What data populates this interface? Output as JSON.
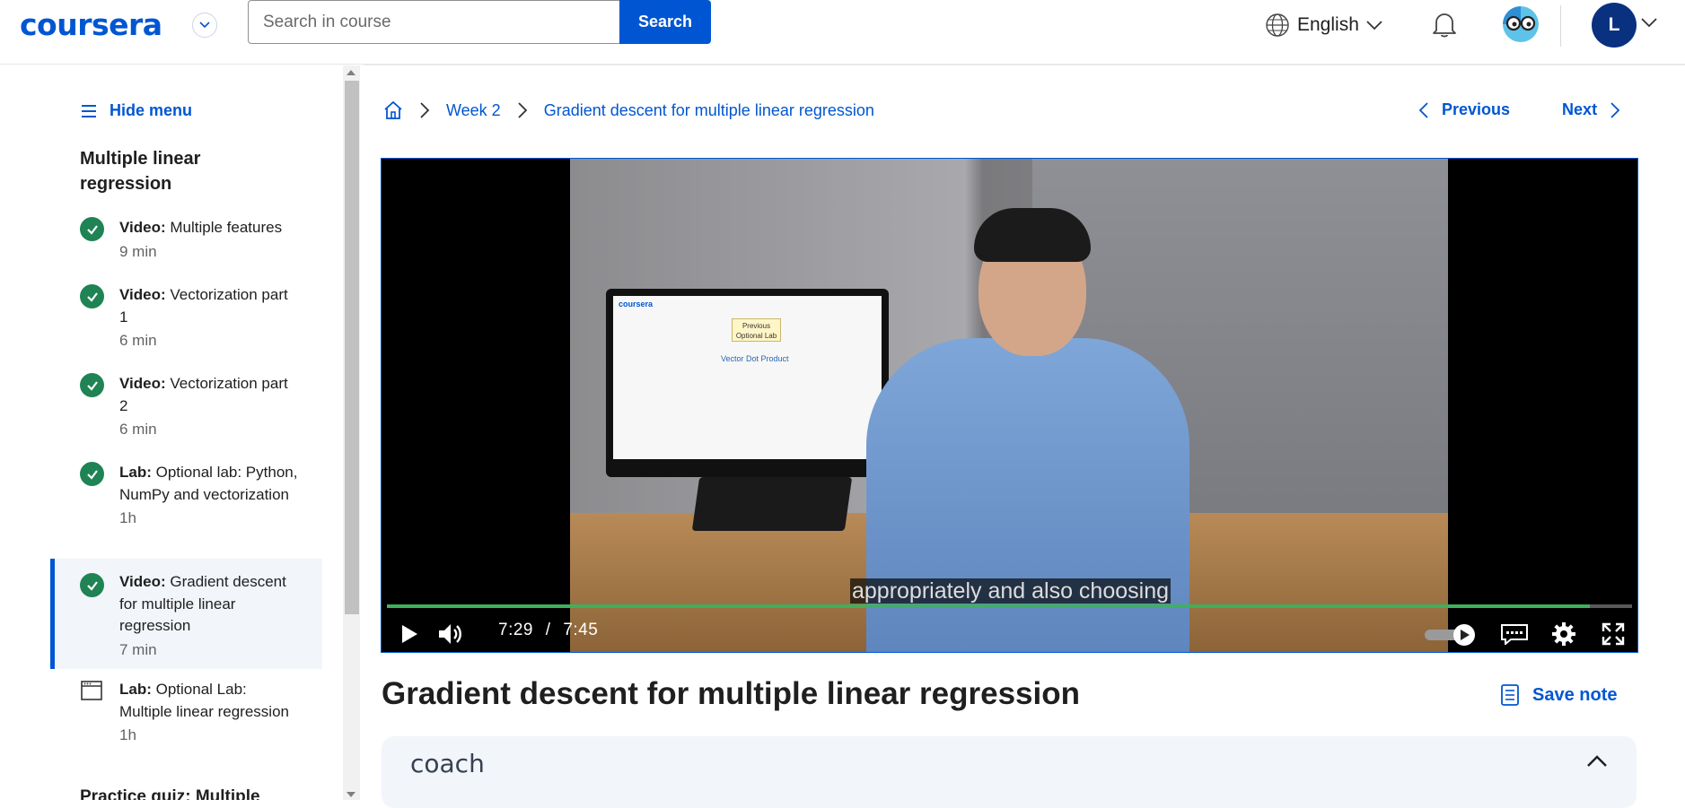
{
  "header": {
    "logo_text": "coursera",
    "search_placeholder": "Search in course",
    "search_button": "Search",
    "language": "English",
    "user_initial": "L",
    "brand_color": "#0056d2"
  },
  "sidebar": {
    "hide_menu": "Hide menu",
    "module_title": "Multiple linear regression",
    "items": [
      {
        "type": "Video:",
        "title": "Multiple features",
        "duration": "9 min",
        "completed": true
      },
      {
        "type": "Video:",
        "title": "Vectorization part 1",
        "duration": "6 min",
        "completed": true
      },
      {
        "type": "Video:",
        "title": "Vectorization part 2",
        "duration": "6 min",
        "completed": true
      },
      {
        "type": "Lab:",
        "title": "Optional lab: Python, NumPy and vectorization",
        "duration": "1h",
        "completed": true
      },
      {
        "type": "Video:",
        "title": "Gradient descent for multiple linear regression",
        "duration": "7 min",
        "completed": true,
        "active": true
      },
      {
        "type": "Lab:",
        "title": "Optional Lab: Multiple linear regression",
        "duration": "1h",
        "completed": false
      }
    ],
    "partial_next": "Practice quiz: Multiple"
  },
  "breadcrumb": {
    "home_icon": "home-icon",
    "week": "Week 2",
    "page": "Gradient descent for multiple linear regression"
  },
  "pager": {
    "previous": "Previous",
    "next": "Next"
  },
  "player": {
    "current_time": "7:29",
    "separator": "/",
    "total_time": "7:45",
    "progress": 0.966,
    "caption": "appropriately and also choosing",
    "screen_brand": "coursera",
    "screen_heading": "Vector Dot Product",
    "tooltip": "Previous Optional Lab",
    "progress_color": "#3fb05d"
  },
  "content": {
    "title": "Gradient descent for multiple linear regression",
    "save_note": "Save note",
    "coach_label": "coach"
  }
}
